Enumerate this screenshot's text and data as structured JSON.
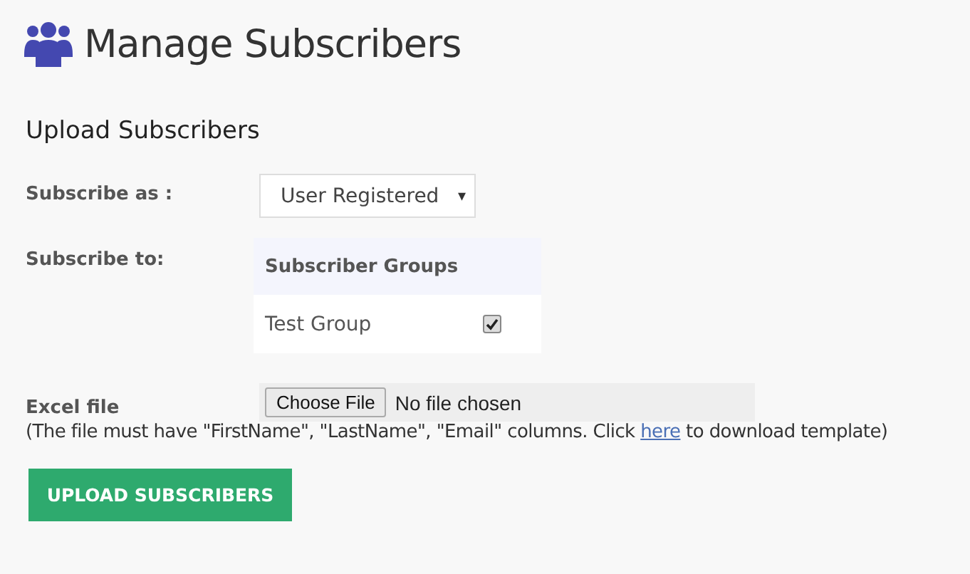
{
  "page_title": "Manage Subscribers",
  "section_title": "Upload Subscribers",
  "subscribe_as": {
    "label": "Subscribe as :",
    "value": "User Registered",
    "caret": "▾"
  },
  "subscribe_to": {
    "label": "Subscribe to:",
    "table": {
      "header": "Subscriber Groups",
      "rows": [
        {
          "name": "Test Group",
          "checked": true
        }
      ]
    }
  },
  "excel_file": {
    "label": "Excel file",
    "button": "Choose File",
    "status": "No file chosen"
  },
  "help": {
    "before": "(The file must have \"FirstName\", \"LastName\", \"Email\" columns. Click ",
    "link": "here",
    "after": " to download template)"
  },
  "submit": "UPLOAD SUBSCRIBERS"
}
